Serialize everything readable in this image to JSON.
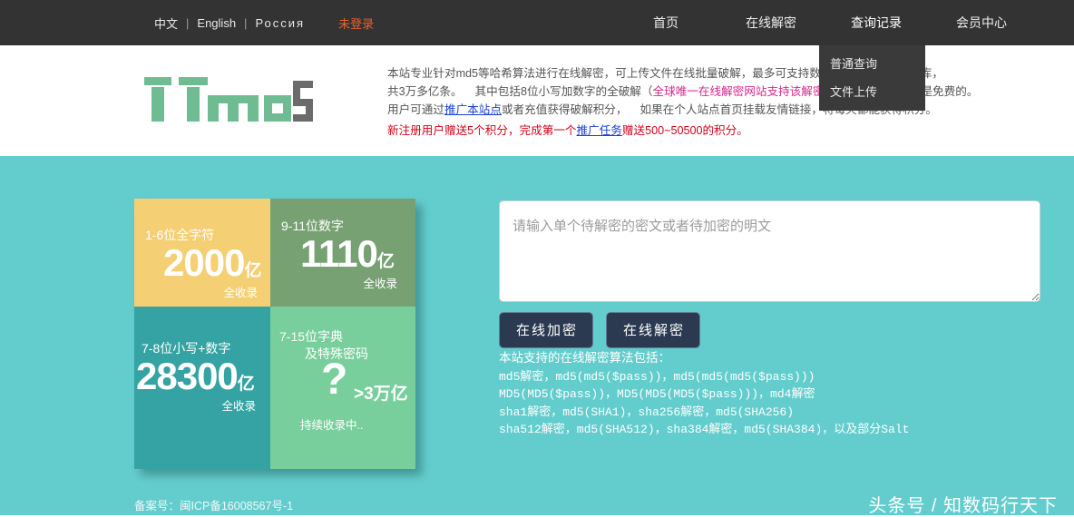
{
  "topbar": {
    "languages": [
      {
        "label": "中文"
      },
      {
        "label": "English"
      },
      {
        "label": "Россия"
      }
    ],
    "separator": "|",
    "login_state": "未登录",
    "nav": [
      {
        "label": "首页"
      },
      {
        "label": "在线解密"
      },
      {
        "label": "查询记录"
      },
      {
        "label": "会员中心"
      }
    ],
    "dropdown": {
      "parent": "查询记录",
      "items": [
        {
          "label": "普通查询"
        },
        {
          "label": "文件上传"
        }
      ]
    }
  },
  "brand": {
    "logo_text": "TTmd5"
  },
  "description": {
    "line1_a": "本站专业针对md5等哈希算法进行在线解密，可上传文件在线批量破解，最多可支持数万个",
    "line1_b": "64T的密码数据库，",
    "line2_a": "共3万多亿条。",
    "line2_b": "其中包括8位小写加数字的全破解（",
    "line2_link": "全球唯一在线解密网站支持该解密范围",
    "line2_c": "），一般的查询是免费的。",
    "line3_a": "用户可通过",
    "line3_link": "推广本站点",
    "line3_b": "或者充值获得破解积分，",
    "line3_c": "如果在个人站点首页挂载友情链接，将每天都能获得积分。",
    "line4_a": "新注册用户赠送5个积分，完成第一个",
    "line4_link": "推广任务",
    "line4_b": "赠送500~50500的积分。"
  },
  "tiles": [
    {
      "label": "1-6位全字符",
      "value": "2000",
      "unit": "亿",
      "sub": "全收录",
      "color": "#f5cf73"
    },
    {
      "label": "9-11位数字",
      "value": "1110",
      "unit": "亿",
      "sub": "全收录",
      "color": "#77a173"
    },
    {
      "label": "7-8位小写+数字",
      "value": "28300",
      "unit": "亿",
      "sub": "全收录",
      "color": "#35a3a3"
    },
    {
      "label_a": "7-15位字典",
      "label_b": "及特殊密码",
      "value": "?",
      "unit": ">3万亿",
      "sub": "持续收录中..",
      "color": "#79cf9c"
    }
  ],
  "form": {
    "placeholder": "请输入单个待解密的密文或者待加密的明文",
    "value": "",
    "encrypt_button": "在线加密",
    "decrypt_button": "在线解密"
  },
  "algorithms": {
    "title": "本站支持的在线解密算法包括：",
    "lines": [
      "md5解密，md5(md5($pass))，md5(md5(md5($pass)))",
      "MD5(MD5($pass))，MD5(MD5(MD5($pass)))，md4解密",
      "sha1解密，md5(SHA1)，sha256解密，md5(SHA256)",
      "sha512解密，md5(SHA512)，sha384解密，md5(SHA384)，以及部分Salt"
    ]
  },
  "footer": {
    "icp": "备案号：闽ICP备16008567号-1",
    "watermark": "头条号 / 知数码行天下"
  },
  "theme": {
    "topbar_bg": "#333333",
    "panel_bg": "#63cdcd",
    "accent_orange": "#e8622b",
    "link_blue": "#1a3fd0",
    "link_pink": "#d6268f",
    "alert_red": "#d0021b",
    "button_bg": "#2b3a50"
  }
}
